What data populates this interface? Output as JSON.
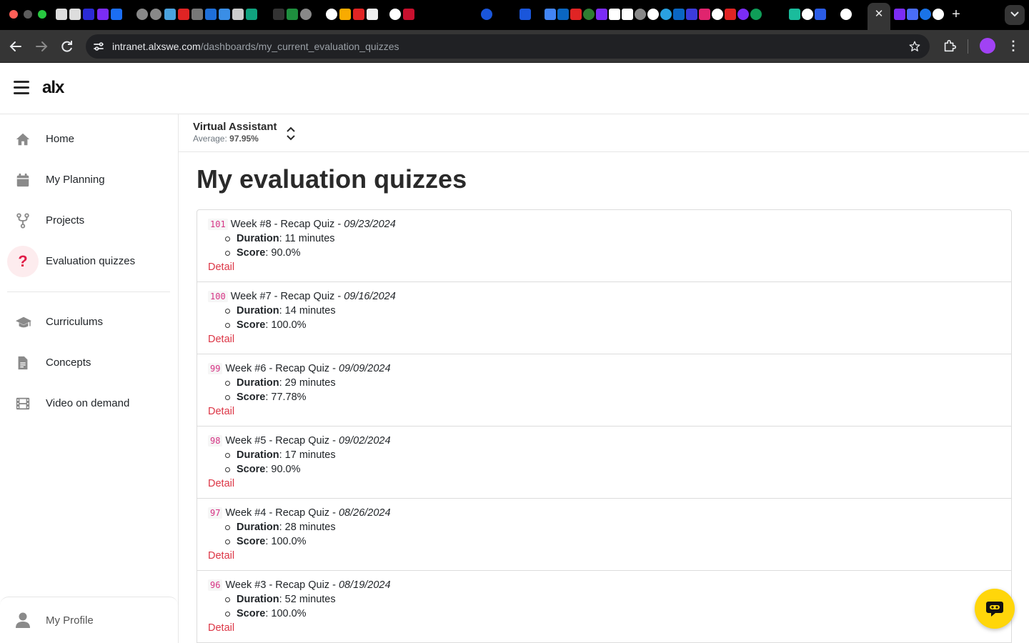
{
  "browser": {
    "url_host": "intranet.alxswe.com",
    "url_path": "/dashboards/my_current_evaluation_quizzes",
    "close_tab_glyph": "✕",
    "new_tab_glyph": "+",
    "menu_glyph": "⋮"
  },
  "header": {
    "logo": "alx"
  },
  "sidebar": {
    "items": [
      {
        "label": "Home",
        "icon": "home-icon"
      },
      {
        "label": "My Planning",
        "icon": "calendar-icon"
      },
      {
        "label": "Projects",
        "icon": "fork-icon"
      },
      {
        "label": "Evaluation quizzes",
        "icon": "question-icon"
      },
      {
        "label": "Curriculums",
        "icon": "graduation-cap-icon"
      },
      {
        "label": "Concepts",
        "icon": "document-icon"
      },
      {
        "label": "Video on demand",
        "icon": "film-icon"
      }
    ],
    "profile_label": "My Profile",
    "question_glyph": "?"
  },
  "cohort": {
    "name": "Virtual Assistant",
    "average_label": "Average:",
    "average_value": "97.95%"
  },
  "page": {
    "title": "My evaluation quizzes"
  },
  "labels": {
    "duration": "Duration",
    "score": "Score",
    "detail": "Detail",
    "separator": "-"
  },
  "quizzes": [
    {
      "id": "101",
      "title": "Week #8 - Recap Quiz",
      "date": "09/23/2024",
      "duration": "11 minutes",
      "score": "90.0%"
    },
    {
      "id": "100",
      "title": "Week #7 - Recap Quiz",
      "date": "09/16/2024",
      "duration": "14 minutes",
      "score": "100.0%"
    },
    {
      "id": "99",
      "title": "Week #6 - Recap Quiz",
      "date": "09/09/2024",
      "duration": "29 minutes",
      "score": "77.78%"
    },
    {
      "id": "98",
      "title": "Week #5 - Recap Quiz",
      "date": "09/02/2024",
      "duration": "17 minutes",
      "score": "90.0%"
    },
    {
      "id": "97",
      "title": "Week #4 - Recap Quiz",
      "date": "08/26/2024",
      "duration": "28 minutes",
      "score": "100.0%"
    },
    {
      "id": "96",
      "title": "Week #3 - Recap Quiz",
      "date": "08/19/2024",
      "duration": "52 minutes",
      "score": "100.0%"
    }
  ],
  "colors": {
    "accent": "#dc3545",
    "chat": "#ffd60a"
  }
}
